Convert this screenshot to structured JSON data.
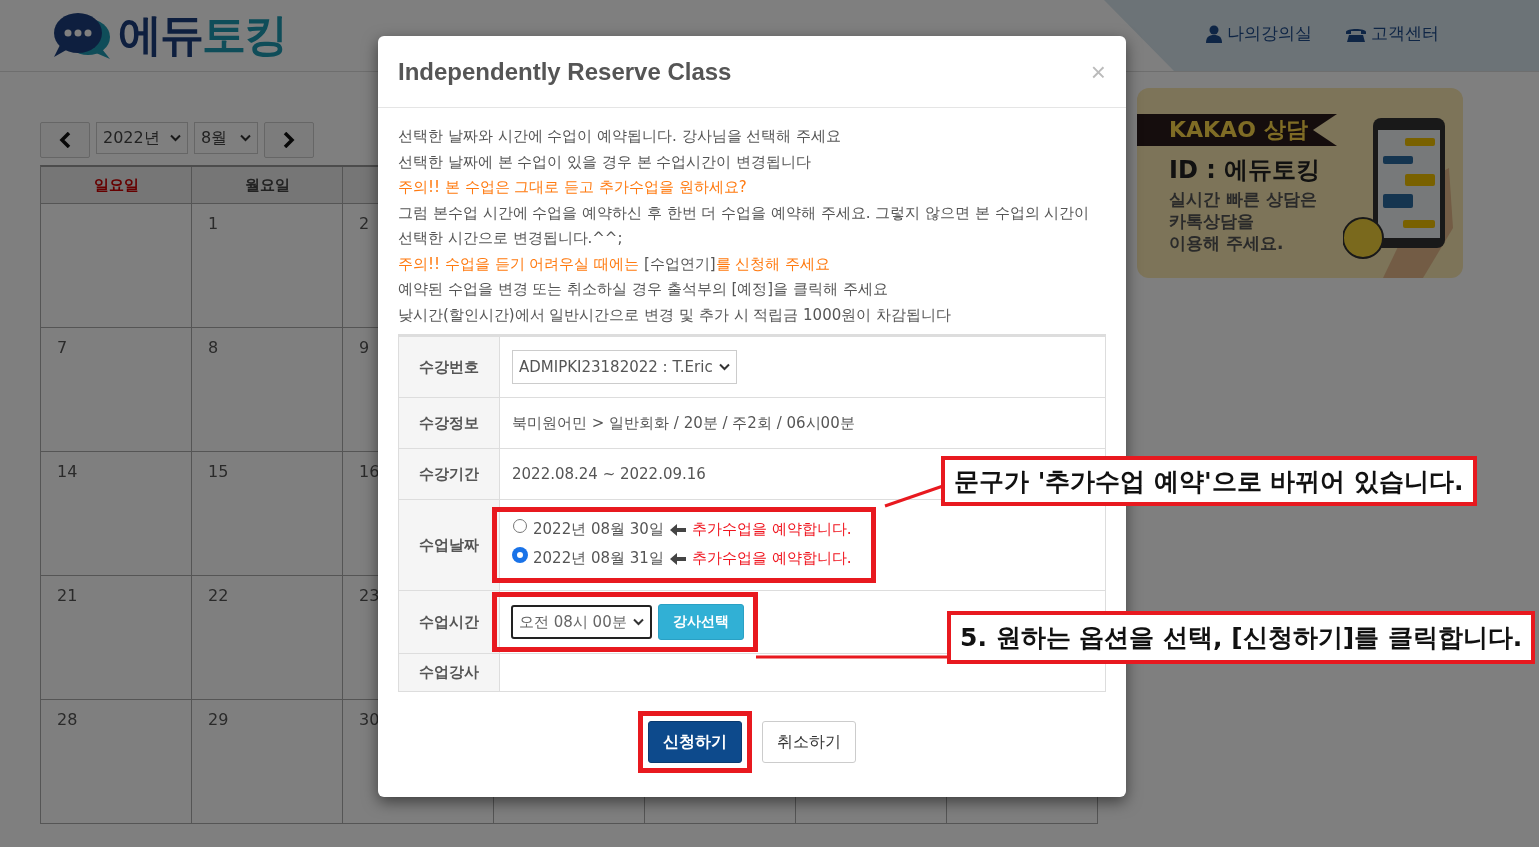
{
  "header": {
    "logo": [
      {
        "text": "에듀",
        "kind": "dark"
      },
      {
        "text": "토킹",
        "kind": "light"
      }
    ],
    "links": [
      {
        "label": "나의강의실",
        "kind": "user"
      },
      {
        "label": "고객센터",
        "kind": "phone"
      }
    ]
  },
  "calendar": {
    "year": "2022년",
    "month": "8월",
    "weekdays": [
      {
        "label": "일요일",
        "kind": "sunday"
      },
      {
        "label": "월요일",
        "kind": "weekday"
      }
    ],
    "weeks": [
      {
        "monday": "1",
        "tuesday": "2"
      },
      {
        "sunday": "7",
        "monday": "8",
        "tuesday": "9"
      },
      {
        "sunday": "14",
        "monday": "15",
        "tuesday": "16"
      },
      {
        "sunday": "21",
        "monday": "22",
        "tuesday": "23"
      },
      {
        "sunday": "28",
        "monday": "29",
        "tuesday": "30"
      }
    ]
  },
  "banner": {
    "title": "KAKAO 상담",
    "id_line": "ID : 에듀토킹",
    "lines": [
      "실시간 빠른 상담은",
      "카톡상담을",
      "이용해 주세요."
    ]
  },
  "modal": {
    "title": "Independently Reserve Class",
    "close": "×",
    "notices": [
      [
        {
          "text": "선택한 날짜와 시간에 수업이 예약됩니다. 강사님을 선택해 주세요",
          "kind": "normal"
        }
      ],
      [
        {
          "text": "선택한 날짜에 본 수업이 있을 경우 본 수업시간이 변경됩니다",
          "kind": "normal"
        }
      ],
      [
        {
          "text": "주의!! 본 수업은 그대로 듣고 추가수업을 원하세요?",
          "kind": "warning"
        }
      ],
      [
        {
          "text": "그럼 본수업 시간에 수업을 예약하신 후 한번 더 수업을 예약해 주세요. 그렇지 않으면 본 수업의 시간이 선택한 시간으로 변경됩니다.^^;",
          "kind": "normal"
        }
      ],
      [
        {
          "text": "주의!! 수업을 듣기 어려우실 때에는 ",
          "kind": "warning"
        },
        {
          "text": "[수업연기]",
          "kind": "normal"
        },
        {
          "text": "를 신청해 주세요",
          "kind": "warning"
        }
      ],
      [
        {
          "text": "예약된 수업을 변경 또는 취소하실 경우 출석부의 [예정]을 클릭해 주세요",
          "kind": "normal"
        }
      ],
      [
        {
          "text": "낮시간(할인시간)에서 일반시간으로 변경 및 추가 시 적립금 1000원이 차감됩니다",
          "kind": "normal"
        }
      ]
    ],
    "rows": [
      {
        "label": "수강번호",
        "kind": "select",
        "value": "ADMIPKI23182022 : T.Eric"
      },
      {
        "label": "수강정보",
        "kind": "text",
        "value": "북미원어민 > 일반회화 / 20분 / 주2회 / 06시00분"
      },
      {
        "label": "수강기간",
        "kind": "text",
        "value": "2022.08.24 ~ 2022.09.16"
      },
      {
        "label": "수업날짜",
        "kind": "radios",
        "highlight": true,
        "options": [
          {
            "date": "2022년 08월 30일",
            "note": "추가수업을 예약합니다.",
            "selected": false
          },
          {
            "date": "2022년 08월 31일",
            "note": "추가수업을 예약합니다.",
            "selected": true
          }
        ]
      },
      {
        "label": "수업시간",
        "kind": "time",
        "highlight": true,
        "value": "오전 08시 00분",
        "button": "강사선택"
      },
      {
        "label": "수업강사",
        "kind": "empty"
      }
    ],
    "buttons": [
      {
        "label": "신청하기",
        "kind": "primary",
        "highlight": true
      },
      {
        "label": "취소하기",
        "kind": "default",
        "highlight": false
      }
    ]
  },
  "callouts": [
    "문구가 '추가수업 예약'으로 바뀌어 있습니다.",
    "5. 원하는 옵션을 선택, [신청하기]를 클릭합니다."
  ]
}
